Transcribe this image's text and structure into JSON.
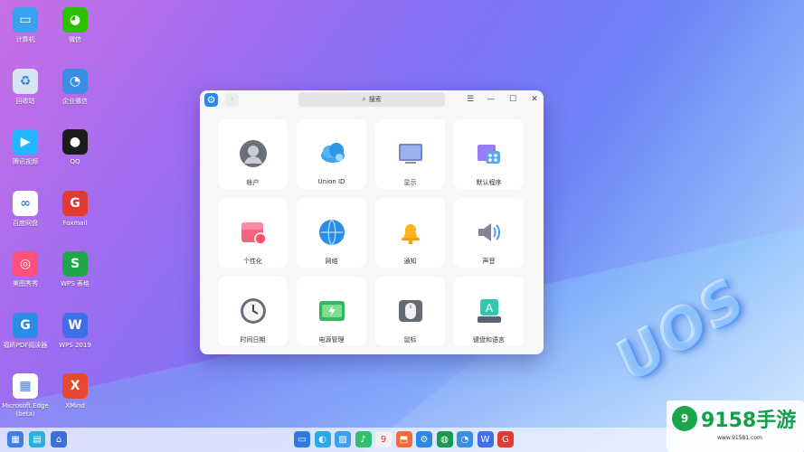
{
  "wallpaper": {
    "logo_text": "UOS"
  },
  "desktop_icons": [
    {
      "label": "计算机",
      "icon": "computer-icon",
      "color": "#3aa0f0",
      "glyph": "▭"
    },
    {
      "label": "微信",
      "icon": "wechat-icon",
      "color": "#2dc100",
      "glyph": "◕"
    },
    {
      "label": "回收站",
      "icon": "trash-icon",
      "color": "#d7e4f2",
      "glyph": "♻"
    },
    {
      "label": "企业微信",
      "icon": "wecom-icon",
      "color": "#3a8ee6",
      "glyph": "◔"
    },
    {
      "label": "腾讯视频",
      "icon": "tencent-video-icon",
      "color": "#26b5ff",
      "glyph": "▶"
    },
    {
      "label": "QQ",
      "icon": "qq-icon",
      "color": "#1d1d1d",
      "glyph": "●"
    },
    {
      "label": "百度网盘",
      "icon": "baidu-netdisk-icon",
      "color": "#ffffff",
      "glyph": "∞"
    },
    {
      "label": "Foxmail",
      "icon": "foxmail-icon",
      "color": "#e03b30",
      "glyph": "G"
    },
    {
      "label": "美图秀秀",
      "icon": "meitu-icon",
      "color": "#ff4f7a",
      "glyph": "◎"
    },
    {
      "label": "WPS 表格",
      "icon": "wps-sheet-icon",
      "color": "#1fa64a",
      "glyph": "S"
    },
    {
      "label": "福昕PDF阅读器",
      "icon": "foxit-pdf-icon",
      "color": "#2d8de6",
      "glyph": "G"
    },
    {
      "label": "WPS 2019",
      "icon": "wps-icon",
      "color": "#3f6ee8",
      "glyph": "W"
    },
    {
      "label": "Microsoft Edge (beta)",
      "icon": "microsoft-icon",
      "color": "#ffffff",
      "glyph": "▦"
    },
    {
      "label": "XMind",
      "icon": "xmind-icon",
      "color": "#e8482f",
      "glyph": "X"
    }
  ],
  "window": {
    "search_placeholder": "搜索",
    "menu_glyph": "☰",
    "minimize_glyph": "—",
    "maximize_glyph": "☐",
    "close_glyph": "✕",
    "back_glyph": "‹",
    "settings": [
      {
        "label": "帐户",
        "icon": "account-icon"
      },
      {
        "label": "Union ID",
        "icon": "cloud-icon"
      },
      {
        "label": "显示",
        "icon": "display-icon"
      },
      {
        "label": "默认程序",
        "icon": "default-apps-icon"
      },
      {
        "label": "个性化",
        "icon": "personalization-icon"
      },
      {
        "label": "网络",
        "icon": "network-icon"
      },
      {
        "label": "通知",
        "icon": "bell-icon"
      },
      {
        "label": "声音",
        "icon": "speaker-icon"
      },
      {
        "label": "时间日期",
        "icon": "clock-icon"
      },
      {
        "label": "电源管理",
        "icon": "battery-icon"
      },
      {
        "label": "鼠标",
        "icon": "mouse-icon"
      },
      {
        "label": "键盘和语言",
        "icon": "keyboard-icon"
      }
    ]
  },
  "taskbar": {
    "left_items": [
      {
        "icon": "multitask-icon",
        "color": "#3f7ee8"
      },
      {
        "icon": "workspace-icon",
        "color": "#2ab0e0"
      },
      {
        "icon": "home-icon",
        "color": "#3a6fd8"
      }
    ],
    "dock_items": [
      {
        "icon": "file-manager-icon",
        "color": "#2e7be0"
      },
      {
        "icon": "browser-icon",
        "color": "#2aa8e8"
      },
      {
        "icon": "image-viewer-icon",
        "color": "#3aa0ee"
      },
      {
        "icon": "music-icon",
        "color": "#32c070"
      },
      {
        "icon": "calendar-icon",
        "color": "#f2f2f2"
      },
      {
        "icon": "app-store-icon",
        "color": "#f26a3c"
      },
      {
        "icon": "settings-icon",
        "color": "#2e86e6"
      },
      {
        "icon": "terminal-icon",
        "color": "#1a9a50"
      },
      {
        "icon": "wecom-dock-icon",
        "color": "#3a8ee6"
      },
      {
        "icon": "wps-dock-icon",
        "color": "#3f6ee8"
      },
      {
        "icon": "foxmail-dock-icon",
        "color": "#e03b30"
      }
    ],
    "calendar_day": "9"
  },
  "watermark": {
    "brand": "9158手游",
    "url": "www.91581.com",
    "circle_glyph": "9"
  }
}
